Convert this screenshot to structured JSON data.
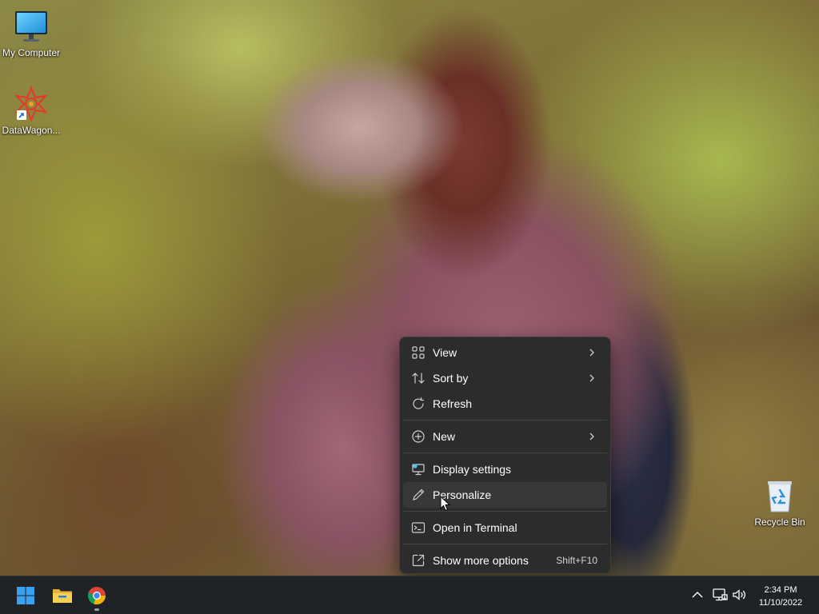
{
  "desktop": {
    "icons": [
      {
        "label": "My Computer",
        "icon": "monitor-icon"
      },
      {
        "label": "DataWagon...",
        "icon": "datawagon-shortcut-icon"
      },
      {
        "label": "Recycle Bin",
        "icon": "recycle-bin-icon"
      }
    ]
  },
  "context_menu": {
    "items": [
      {
        "label": "View",
        "icon": "view-grid-icon",
        "submenu": true
      },
      {
        "label": "Sort by",
        "icon": "sort-icon",
        "submenu": true
      },
      {
        "label": "Refresh",
        "icon": "refresh-icon"
      },
      {
        "label": "New",
        "icon": "plus-circle-icon",
        "submenu": true
      },
      {
        "label": "Display settings",
        "icon": "display-settings-icon"
      },
      {
        "label": "Personalize",
        "icon": "pencil-icon",
        "hovered": true
      },
      {
        "label": "Open in Terminal",
        "icon": "terminal-icon"
      },
      {
        "label": "Show more options",
        "icon": "open-external-icon",
        "shortcut": "Shift+F10"
      }
    ]
  },
  "taskbar": {
    "pinned": [
      {
        "name": "start",
        "icon": "windows-logo-icon"
      },
      {
        "name": "file-explorer",
        "icon": "folder-icon"
      },
      {
        "name": "chrome",
        "icon": "chrome-icon",
        "running": true
      }
    ],
    "tray": [
      "chevron-up-icon",
      "network-icon",
      "volume-icon"
    ],
    "clock": {
      "time": "2:34 PM",
      "date": "11/10/2022"
    }
  },
  "colors": {
    "menu_bg": "#2c2c2c",
    "menu_hover": "#383838",
    "taskbar_bg": "#1f2227",
    "accent": "#4cc2ff"
  }
}
